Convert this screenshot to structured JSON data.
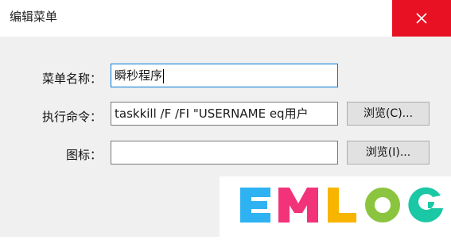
{
  "window": {
    "title": "编辑菜单"
  },
  "form": {
    "name_label": "菜单名称：",
    "name_value": "瞬秒程序",
    "command_label": "执行命令：",
    "command_value": "taskkill /F /FI \"USERNAME eq用户",
    "icon_label": "图标：",
    "icon_value": "",
    "browse_command_label": "浏览(C)...",
    "browse_icon_label": "浏览(I)..."
  },
  "watermark": {
    "text": "EMLOG",
    "colors": [
      "#2eb2f2",
      "#f2337a",
      "#f7b500",
      "#8bc53f",
      "#1bc8a5"
    ]
  },
  "colors": {
    "close_bg": "#e81123",
    "focus_border": "#0078d7"
  }
}
